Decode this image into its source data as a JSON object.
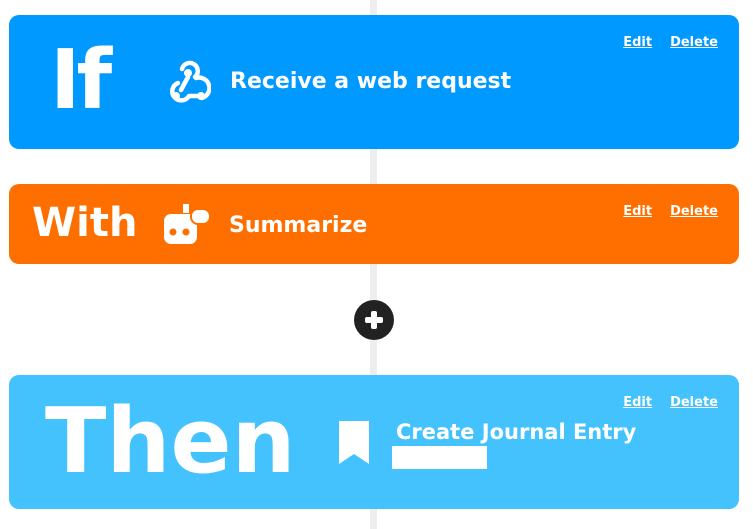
{
  "if_step": {
    "keyword": "If",
    "title": "Receive a web request",
    "icon": "webhook-icon",
    "edit_label": "Edit",
    "delete_label": "Delete",
    "color": "#0099ff"
  },
  "with_step": {
    "keyword": "With",
    "title": "Summarize",
    "icon": "ai-robot-icon",
    "edit_label": "Edit",
    "delete_label": "Delete",
    "color": "#ff6f00"
  },
  "add_step": {
    "icon": "plus-icon"
  },
  "then_step": {
    "keyword": "Then",
    "title": "Create Journal Entry",
    "icon": "bookmark-icon",
    "edit_label": "Edit",
    "delete_label": "Delete",
    "color": "#44c2fd"
  }
}
